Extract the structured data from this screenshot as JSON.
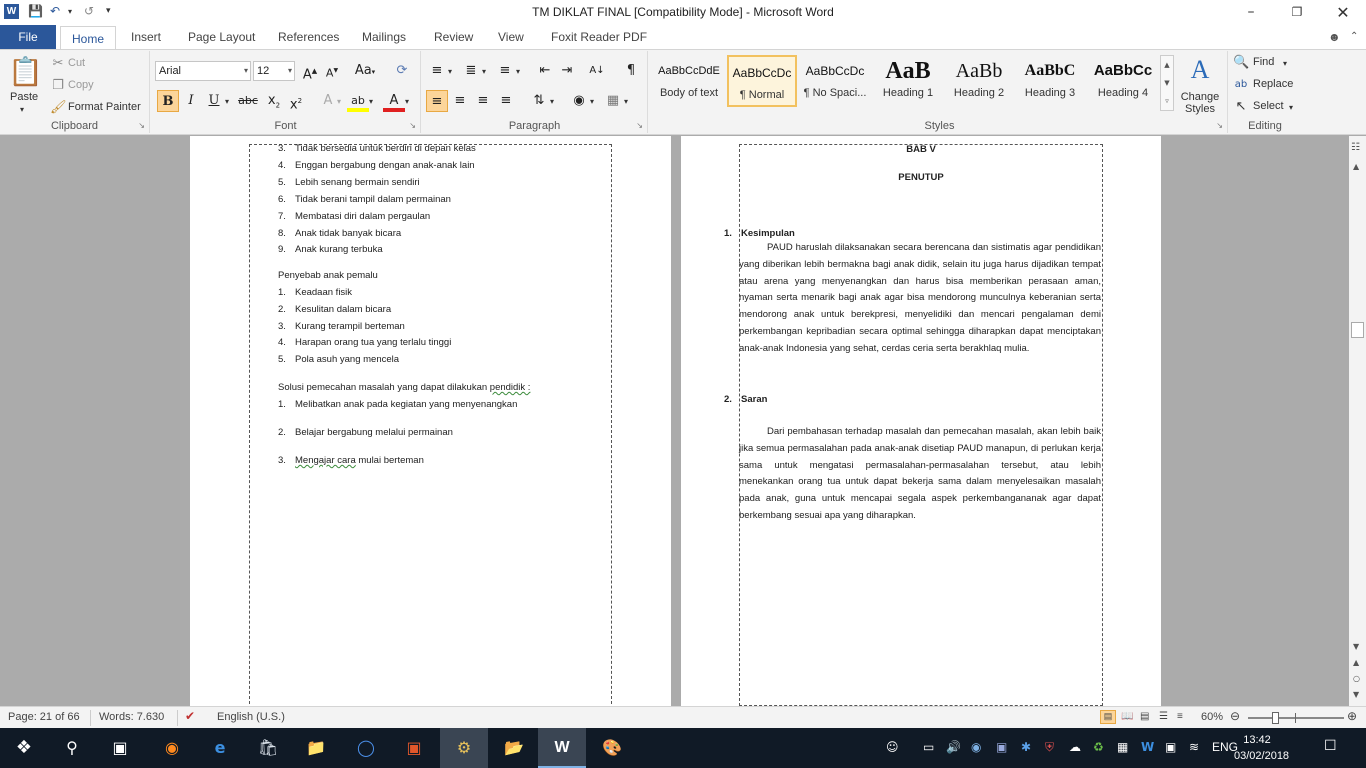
{
  "window": {
    "title": "TM DIKLAT FINAL [Compatibility Mode]  -  Microsoft Word"
  },
  "tabs": [
    "File",
    "Home",
    "Insert",
    "Page Layout",
    "References",
    "Mailings",
    "Review",
    "View",
    "Foxit Reader PDF"
  ],
  "clipboard": {
    "paste": "Paste",
    "cut": "Cut",
    "copy": "Copy",
    "format_painter": "Format Painter",
    "label": "Clipboard"
  },
  "font": {
    "name": "Arial",
    "size": "12",
    "label": "Font"
  },
  "paragraph": {
    "label": "Paragraph"
  },
  "styles": {
    "label": "Styles",
    "items": [
      {
        "preview": "AaBbCcDdE",
        "name": "Body of text"
      },
      {
        "preview": "AaBbCcDc",
        "name": "¶ Normal"
      },
      {
        "preview": "AaBbCcDc",
        "name": "¶ No Spaci..."
      },
      {
        "preview": "AaB",
        "name": "Heading 1"
      },
      {
        "preview": "AaBb",
        "name": "Heading 2"
      },
      {
        "preview": "AaBbC",
        "name": "Heading 3"
      },
      {
        "preview": "AaBbCc",
        "name": "Heading 4"
      }
    ],
    "change_styles": "Change Styles"
  },
  "editing": {
    "find": "Find",
    "replace": "Replace",
    "select": "Select",
    "label": "Editing"
  },
  "left_page": {
    "list1": [
      {
        "n": "3.",
        "t": "Tidak bersedia untuk berdiri di depan kelas"
      },
      {
        "n": "4.",
        "t": "Enggan bergabung dengan anak-anak lain"
      },
      {
        "n": "5.",
        "t": "Lebih senang bermain sendiri"
      },
      {
        "n": "6.",
        "t": "Tidak berani tampil dalam permainan"
      },
      {
        "n": "7.",
        "t": "Membatasi diri dalam pergaulan"
      },
      {
        "n": "8.",
        "t": "Anak tidak banyak bicara"
      },
      {
        "n": "9.",
        "t": "Anak kurang terbuka"
      }
    ],
    "heading2": "Penyebab anak pemalu",
    "list2": [
      {
        "n": "1.",
        "t": "Keadaan fisik"
      },
      {
        "n": "2.",
        "t": "Kesulitan dalam bicara"
      },
      {
        "n": "3.",
        "t": "Kurang terampil berteman"
      },
      {
        "n": "4.",
        "t": "Harapan orang tua yang terlalu tinggi"
      },
      {
        "n": "5.",
        "t": "Pola asuh yang mencela"
      }
    ],
    "heading3_a": "Solusi pemecahan masalah yang dapat dilakukan ",
    "heading3_b": "pendidik :",
    "list3": [
      {
        "n": "1.",
        "t": "Melibatkan anak pada kegiatan yang menyenangkan"
      },
      {
        "n": "2.",
        "t": "Belajar bergabung melalui permainan"
      }
    ],
    "item3_n": "3.",
    "item3_a": "Mengajar cara",
    "item3_b": " mulai berteman"
  },
  "right_page": {
    "bab": "BAB V",
    "penutup": "PENUTUP",
    "s1_num": "1.",
    "s1_title": "Kesimpulan",
    "s1_para": "PAUD haruslah dilaksanakan secara berencana dan sistimatis agar pendidikan yang diberikan lebih bermakna bagi anak didik, selain itu juga harus dijadikan tempat atau arena yang menyenangkan dan harus bisa memberikan perasaan aman, nyaman serta menarik bagi anak agar bisa mendorong munculnya keberanian serta mendorong anak untuk berekpresi, menyelidiki dan mencari pengalaman demi perkembangan kepribadian secara optimal sehingga diharapkan dapat menciptakan anak-anak Indonesia yang sehat, cerdas ceria serta berakhlaq mulia.",
    "s2_num": "2.",
    "s2_title": "Saran",
    "s2_para": "Dari pembahasan terhadap masalah dan  pemecahan masalah, akan lebih baik jika semua permasalahan pada anak-anak disetiap PAUD manapun, di perlukan kerja sama untuk mengatasi permasalahan-permasalahan tersebut, atau lebih menekankan orang tua untuk dapat bekerja sama dalam menyelesaikan masalah pada anak, guna untuk mencapai segala aspek perkembangananak agar dapat berkembang sesuai apa yang diharapkan."
  },
  "status": {
    "page": "Page: 21 of 66",
    "words": "Words: 7.630",
    "language": "English (U.S.)",
    "zoom": "60%",
    "zoom_level": 0.6
  },
  "taskbar": {
    "lang": "ENG",
    "time": "13:42",
    "date": "03/02/2018"
  }
}
